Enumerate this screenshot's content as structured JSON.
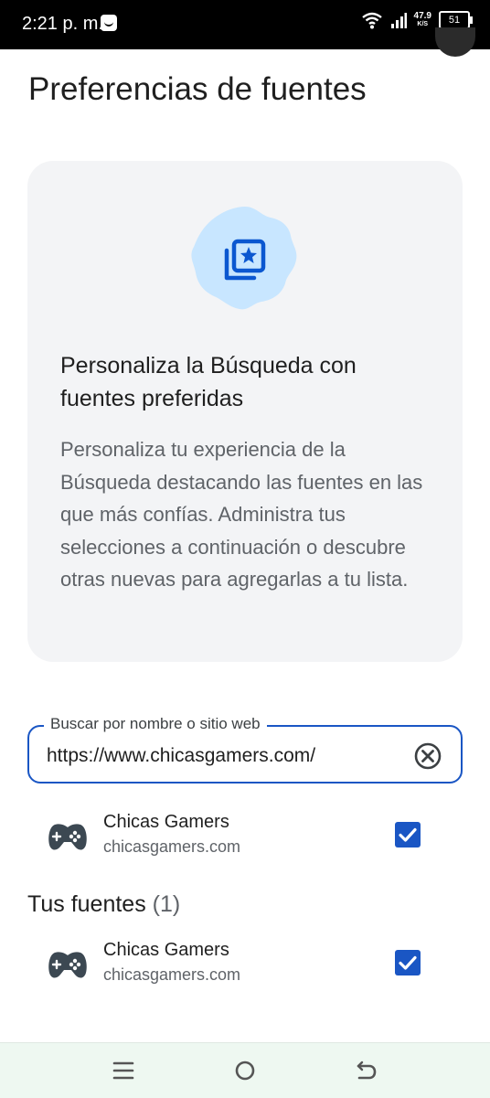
{
  "status_bar": {
    "time": "2:21 p. m.",
    "speed_value": "47.9",
    "speed_unit": "K/S",
    "battery": "51"
  },
  "page": {
    "title": "Preferencias de fuentes"
  },
  "info_card": {
    "icon": "star-photos-icon",
    "heading": "Personaliza la Búsqueda con fuentes preferidas",
    "body": "Personaliza tu experiencia de la Búsqueda destacando las fuentes en las que más confías. Administra tus selecciones a continuación o descubre otras nuevas para agregarlas a tu lista."
  },
  "search": {
    "label": "Buscar por nombre o sitio web",
    "value": "https://www.chicasgamers.com/"
  },
  "search_results": [
    {
      "name": "Chicas Gamers",
      "site": "chicasgamers.com",
      "icon": "gamepad-icon",
      "checked": true
    }
  ],
  "your_sources": {
    "title": "Tus fuentes",
    "count": "(1)",
    "items": [
      {
        "name": "Chicas Gamers",
        "site": "chicasgamers.com",
        "icon": "gamepad-icon",
        "checked": true
      }
    ]
  },
  "nav_bar": [
    "menu-icon",
    "home-circle-icon",
    "back-icon"
  ],
  "colors": {
    "accent": "#1a56c4",
    "card_bg": "#f3f4f6",
    "badge_bg": "#c8e6ff",
    "badge_icon": "#0b57d0"
  }
}
